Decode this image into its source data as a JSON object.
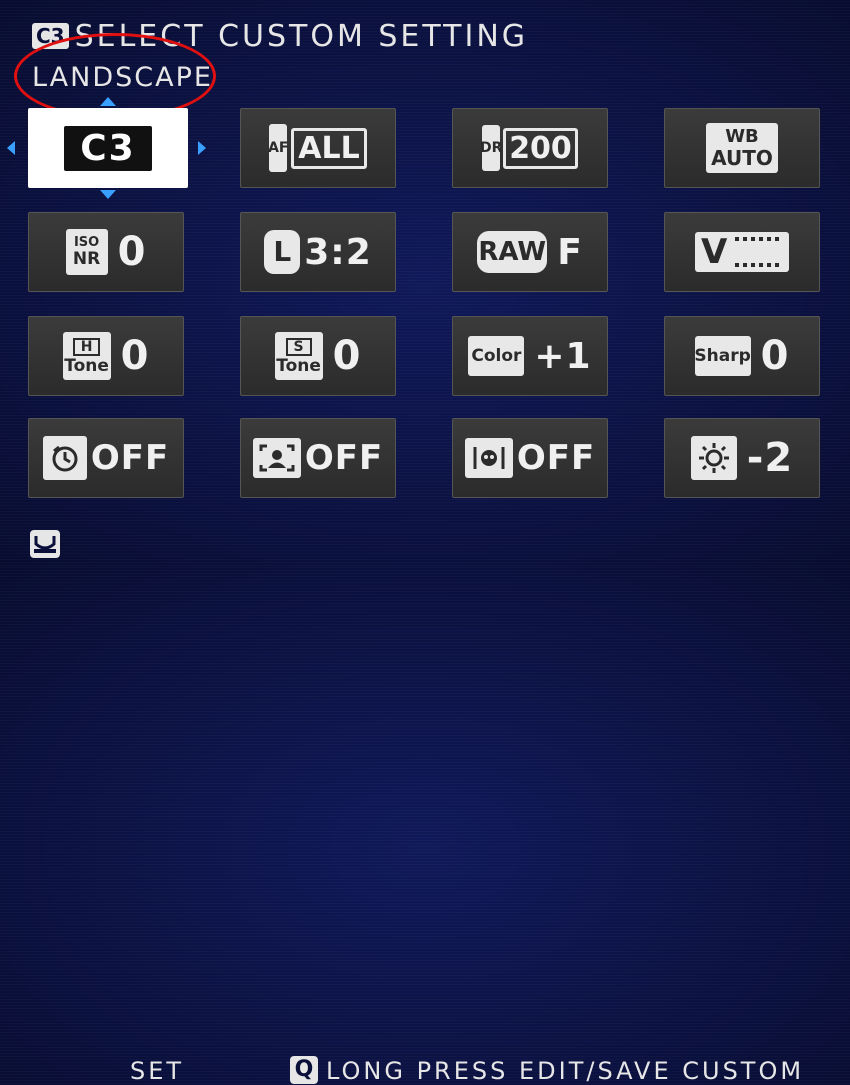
{
  "header": {
    "badge": "C3",
    "title": "SELECT CUSTOM SETTING",
    "subtitle": "LANDSCAPE"
  },
  "selected_slot": "C3",
  "tiles": [
    {
      "id": "af-mode",
      "icon_top": "AF",
      "icon_main": "ALL",
      "value": ""
    },
    {
      "id": "dynamic-range",
      "icon_top": "DR",
      "icon_main": "200",
      "value": ""
    },
    {
      "id": "white-balance",
      "icon_top": "WB",
      "icon_main": "AUTO",
      "value": ""
    },
    {
      "id": "iso-nr",
      "icon_top": "ISO",
      "icon_main": "NR",
      "value": "0"
    },
    {
      "id": "image-size",
      "icon_top": "L",
      "icon_main": "3:2",
      "value": ""
    },
    {
      "id": "image-quality",
      "icon_top": "RAW",
      "icon_main": "F",
      "value": ""
    },
    {
      "id": "film-simulation",
      "icon_top": "V",
      "icon_main": "",
      "value": ""
    },
    {
      "id": "highlight-tone",
      "icon_top": "H",
      "icon_main": "Tone",
      "value": "0"
    },
    {
      "id": "shadow-tone",
      "icon_top": "S",
      "icon_main": "Tone",
      "value": "0"
    },
    {
      "id": "color",
      "icon_top": "Color",
      "icon_main": "",
      "value": "+1"
    },
    {
      "id": "sharpness",
      "icon_top": "Sharp",
      "icon_main": "",
      "value": "0"
    },
    {
      "id": "self-timer",
      "icon_top": "",
      "icon_main": "",
      "value": "OFF"
    },
    {
      "id": "face-detection",
      "icon_top": "",
      "icon_main": "",
      "value": "OFF"
    },
    {
      "id": "eye-detection",
      "icon_top": "",
      "icon_main": "",
      "value": "OFF"
    },
    {
      "id": "brightness",
      "icon_top": "",
      "icon_main": "",
      "value": "-2"
    }
  ],
  "footer": {
    "set_label": "SET",
    "q_badge": "Q",
    "q_label": "LONG PRESS EDIT/SAVE CUSTOM"
  },
  "colors": {
    "background": "#0a0f3a",
    "tile": "#333333",
    "selection_arrow": "#3aa0ff",
    "highlight_circle": "#e01010"
  }
}
